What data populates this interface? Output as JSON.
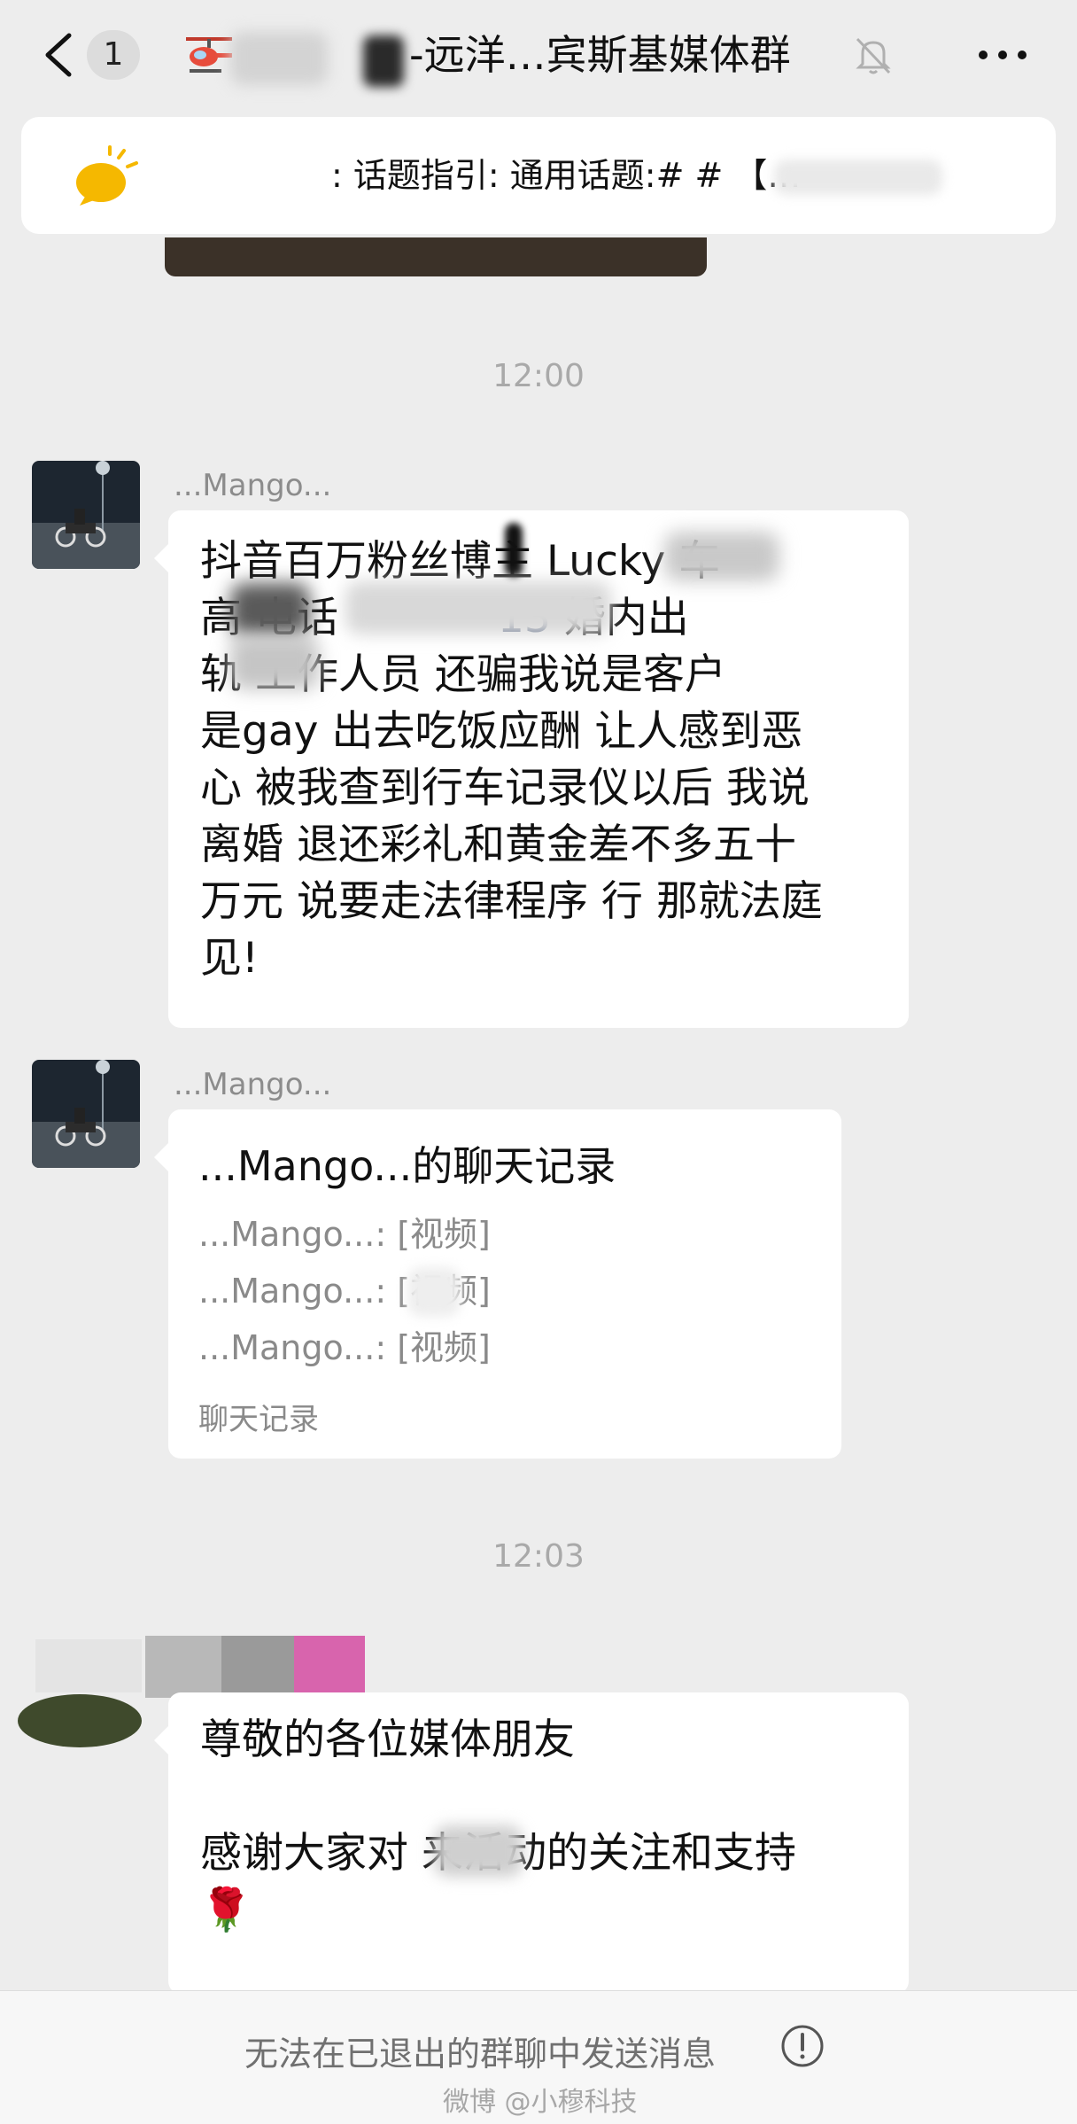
{
  "header": {
    "unread_count": "1",
    "title": "-远洋…宾斯基媒体群"
  },
  "topic_bar": {
    "text": ": 话题指引:  通用话题:#    #  【…"
  },
  "messages": [
    {
      "type": "time",
      "text": "12:00"
    },
    {
      "type": "text",
      "sender": "...Mango...",
      "lines": [
        "抖音百万粉丝博主 Lucky   车",
        "高     电话",
        "轨     工作人员 还骗我说是客户",
        "是gay 出去吃饭应酬 让人感到恶",
        "心 被我查到行车记录仪以后 我说",
        "离婚 退还彩礼和黄金差不多五十",
        "万元 说要走法律程序 行 那就法庭",
        "见!"
      ],
      "phone_fragment": "13",
      "after_phone": " 婚内出"
    },
    {
      "type": "chat_record",
      "sender": "...Mango...",
      "title": "...Mango...的聊天记录",
      "items": [
        "...Mango...: [视频]",
        "...Mango...: [视频]",
        "...Mango...: [视频]"
      ],
      "footer": "聊天记录"
    },
    {
      "type": "time",
      "text": "12:03"
    },
    {
      "type": "text",
      "sender": "",
      "lines": [
        "尊敬的各位媒体朋友",
        "",
        "感谢大家对   来活动的关注和支持",
        "🌹"
      ]
    }
  ],
  "bottom": {
    "notice": "无法在已退出的群聊中发送消息",
    "watermark": "微博 @小穆科技"
  },
  "icons": [
    "back-arrow-icon",
    "helicopter-icon",
    "mute-bell-icon",
    "more-dots-icon",
    "speech-bubble-sun-icon",
    "info-icon"
  ]
}
